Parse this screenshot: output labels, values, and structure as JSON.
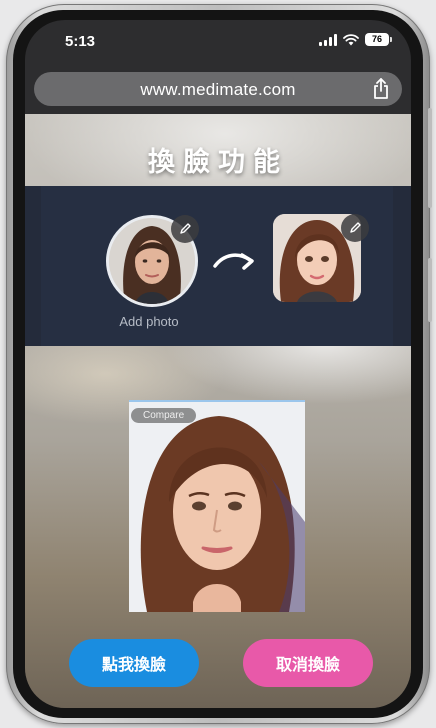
{
  "status_bar": {
    "time": "5:13",
    "battery": "76"
  },
  "browser": {
    "url": "www.medimate.com"
  },
  "page": {
    "title": "換臉功能",
    "add_photo_label": "Add photo",
    "compare_label": "Compare",
    "swap_button_label": "點我換臉",
    "cancel_button_label": "取消換臉"
  },
  "colors": {
    "panel": "#242b3b",
    "swap_button": "#1a8de0",
    "cancel_button": "#e859a9"
  },
  "icons": [
    "signal-icon",
    "wifi-icon",
    "battery-icon",
    "share-icon",
    "pencil-icon",
    "curved-arrow-icon"
  ]
}
